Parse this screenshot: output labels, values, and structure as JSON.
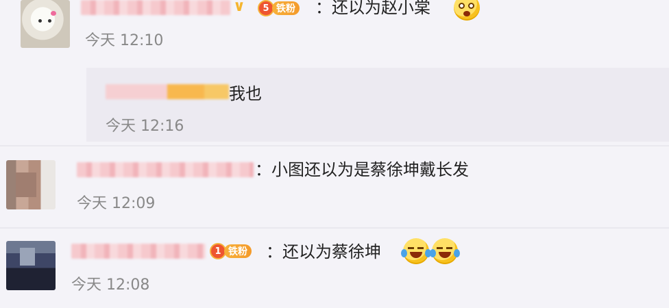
{
  "comments": [
    {
      "text": "：还以为赵小棠",
      "badge_level": "5",
      "badge_label": "铁粉",
      "time": "今天 12:10",
      "emoji": [
        "surprised-emoji"
      ],
      "reply": {
        "text": "我也",
        "time": "今天 12:16"
      }
    },
    {
      "text": "：小图还以为是蔡徐坤戴长发",
      "time": "今天 12:09"
    },
    {
      "text": "：还以为蔡徐坤",
      "badge_level": "1",
      "badge_label": "铁粉",
      "time": "今天 12:08",
      "emoji": [
        "laugh-cry-emoji",
        "laugh-cry-emoji"
      ]
    }
  ],
  "colors": {
    "background": "#f4f3f8",
    "reply_background": "#eceaf1",
    "badge_orange": "#f49a2a",
    "timestamp": "#888888"
  }
}
